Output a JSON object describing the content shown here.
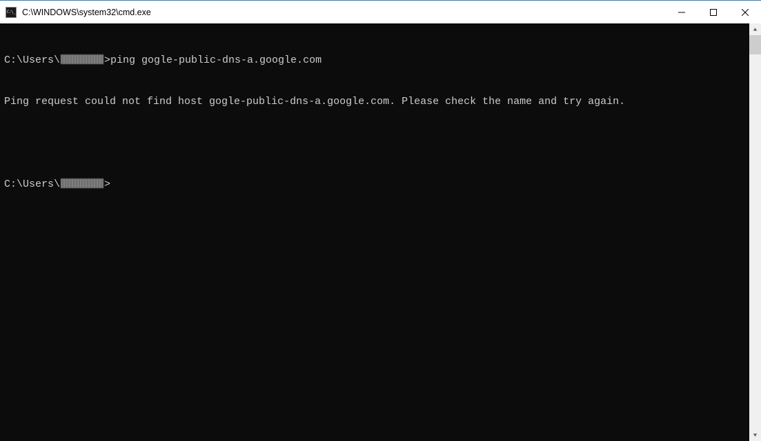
{
  "window": {
    "title": "C:\\WINDOWS\\system32\\cmd.exe"
  },
  "terminal": {
    "line1_prefix": "C:\\Users\\",
    "line1_suffix": ">ping gogle-public-dns-a.google.com",
    "line2": "Ping request could not find host gogle-public-dns-a.google.com. Please check the name and try again.",
    "line3": "",
    "line4_prefix": "C:\\Users\\",
    "line4_suffix": ">"
  }
}
